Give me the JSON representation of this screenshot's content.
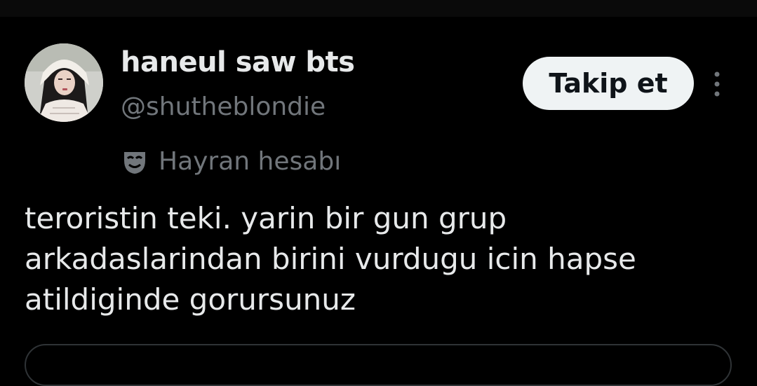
{
  "tweet": {
    "author": {
      "display_name": "haneul saw bts",
      "handle": "@shutheblondie",
      "avatar_icon": "profile-photo"
    },
    "follow_button_label": "Takip et",
    "more_icon": "vertical-ellipsis-icon",
    "account_label": {
      "icon": "theater-mask-icon",
      "text": "Hayran hesabı"
    },
    "body": "teroristin teki. yarin bir gun grup arkadaslarindan birini vurdugu icin hapse atildiginde gorursunuz"
  },
  "colors": {
    "background": "#000000",
    "primary_text": "#e7e9ea",
    "secondary_text": "#71767b",
    "button_bg": "#eff3f4",
    "button_text": "#0f1419",
    "border": "#2f3336"
  }
}
